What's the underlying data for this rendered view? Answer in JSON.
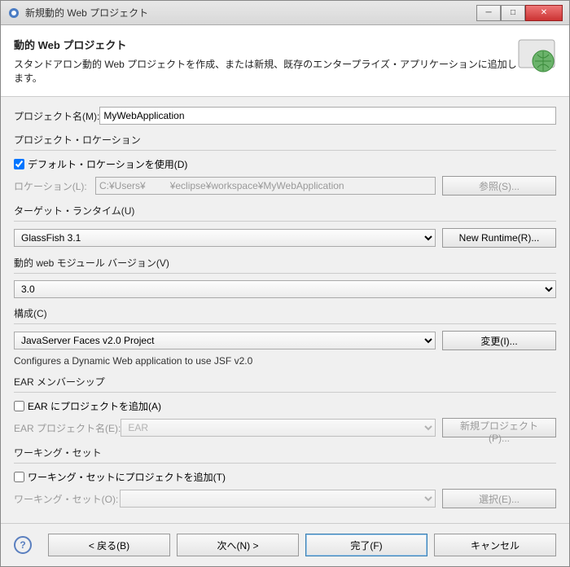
{
  "window": {
    "title": "新規動的 Web プロジェクト"
  },
  "banner": {
    "heading": "動的 Web プロジェクト",
    "subtext": "スタンドアロン動的 Web プロジェクトを作成、または新規、既存のエンタープライズ・アプリケーションに追加します。"
  },
  "projectName": {
    "label": "プロジェクト名(M):",
    "value": "MyWebApplication"
  },
  "location": {
    "groupLabel": "プロジェクト・ロケーション",
    "useDefaultLabel": "デフォルト・ロケーションを使用(D)",
    "useDefault": true,
    "pathLabel": "ロケーション(L):",
    "path": "C:¥Users¥         ¥eclipse¥workspace¥MyWebApplication",
    "browse": "参照(S)..."
  },
  "runtime": {
    "groupLabel": "ターゲット・ランタイム(U)",
    "value": "GlassFish 3.1",
    "newBtn": "New Runtime(R)..."
  },
  "module": {
    "groupLabel": "動的 web モジュール バージョン(V)",
    "value": "3.0"
  },
  "config": {
    "groupLabel": "構成(C)",
    "value": "JavaServer Faces v2.0 Project",
    "modifyBtn": "変更(I)...",
    "desc": "Configures a Dynamic Web application to use JSF v2.0"
  },
  "ear": {
    "groupLabel": "EAR メンバーシップ",
    "addLabel": "EAR にプロジェクトを追加(A)",
    "add": false,
    "projLabel": "EAR プロジェクト名(E):",
    "projValue": "EAR",
    "newBtn": "新規プロジェクト(P)..."
  },
  "ws": {
    "groupLabel": "ワーキング・セット",
    "addLabel": "ワーキング・セットにプロジェクトを追加(T)",
    "add": false,
    "setLabel": "ワーキング・セット(O):",
    "selectBtn": "選択(E)..."
  },
  "footer": {
    "back": "< 戻る(B)",
    "next": "次へ(N) >",
    "finish": "完了(F)",
    "cancel": "キャンセル"
  }
}
